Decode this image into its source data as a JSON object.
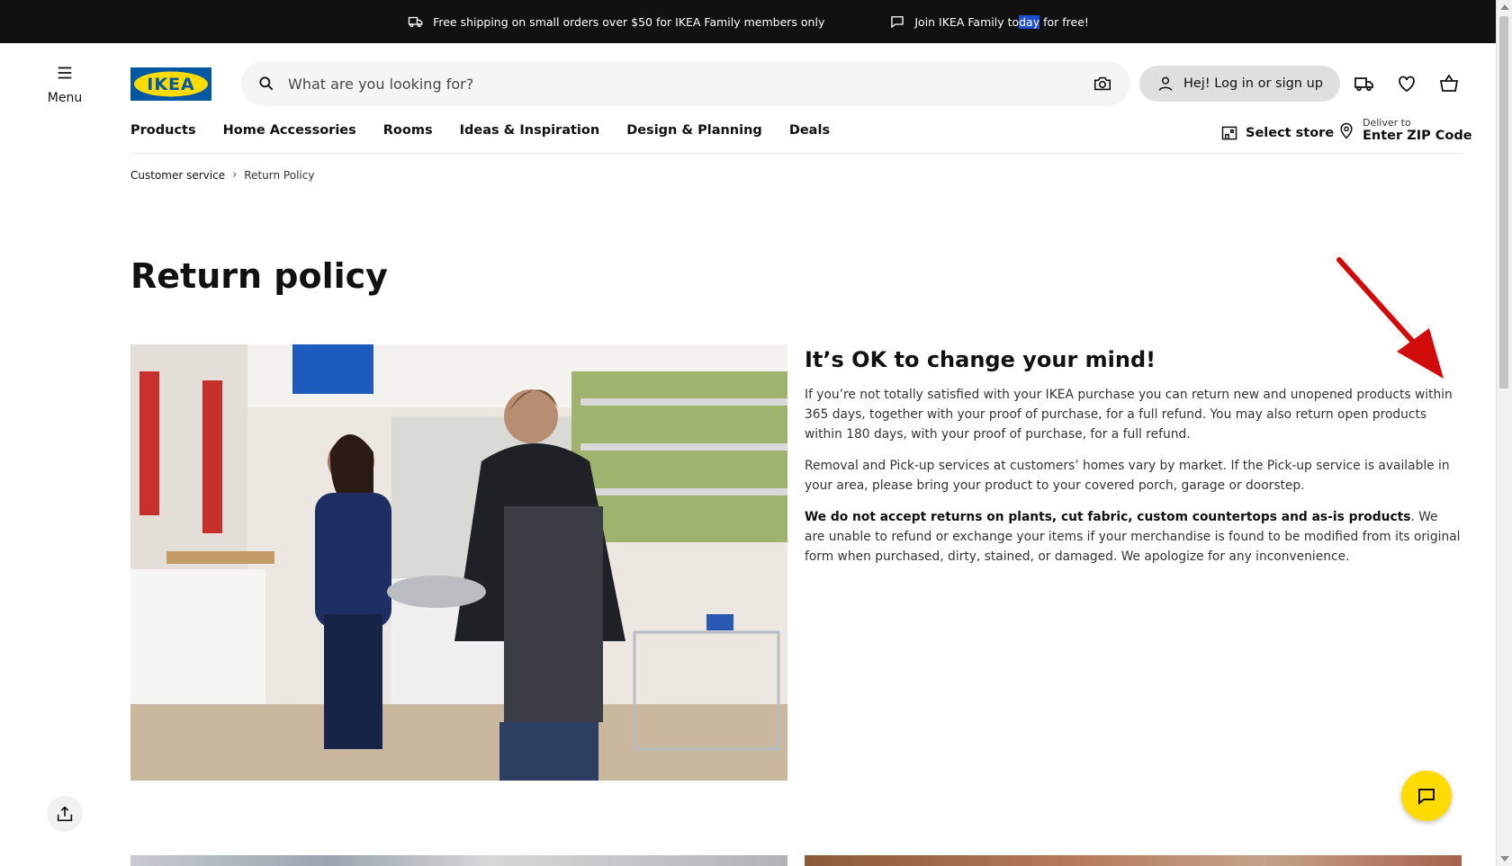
{
  "promo": {
    "shipping_text": "Free shipping on small orders over $50 for IKEA Family members only",
    "family_pre": "Join IKEA Family to",
    "family_highlight": "day",
    "family_post": " for free!"
  },
  "header": {
    "menu_label": "Menu",
    "logo_text": "IKEA",
    "search_placeholder": "What are you looking for?",
    "login_label": "Hej! Log in or sign up",
    "icons": [
      "delivery-truck-icon",
      "heart-icon",
      "shopping-bag-icon"
    ]
  },
  "nav": {
    "items": [
      "Products",
      "Home Accessories",
      "Rooms",
      "Ideas & Inspiration",
      "Design & Planning",
      "Deals"
    ],
    "store_label": "Select store",
    "deliver_small": "Deliver to",
    "deliver_big": "Enter ZIP Code"
  },
  "breadcrumb": {
    "items": [
      "Customer service",
      "Return Policy"
    ]
  },
  "page": {
    "title": "Return policy",
    "heading": "It’s OK to change your mind!",
    "p1": "If you’re not totally satisfied with your IKEA purchase you can return new and unopened products within 365 days, together with your proof of purchase, for a full refund.  You may also return open products within 180 days, with your proof of purchase, for a full refund.",
    "p2": "Removal and Pick-up services at customers’ homes vary by market. If the Pick-up service is available in your area, please bring your product to your covered porch, garage or doorstep.",
    "p3_bold": "We do not accept returns on plants, cut fabric, custom countertops and as-is products",
    "p3_rest": ".  We are unable to refund or exchange your items if your merchandise is found to be modified from its original form when purchased, dirty, stained, or damaged.  We apologize for any inconvenience."
  },
  "colors": {
    "ikea_blue": "#0058a3",
    "ikea_yellow": "#ffdb00",
    "promo_bg": "#111111",
    "annotation_red": "#d10a0a"
  }
}
